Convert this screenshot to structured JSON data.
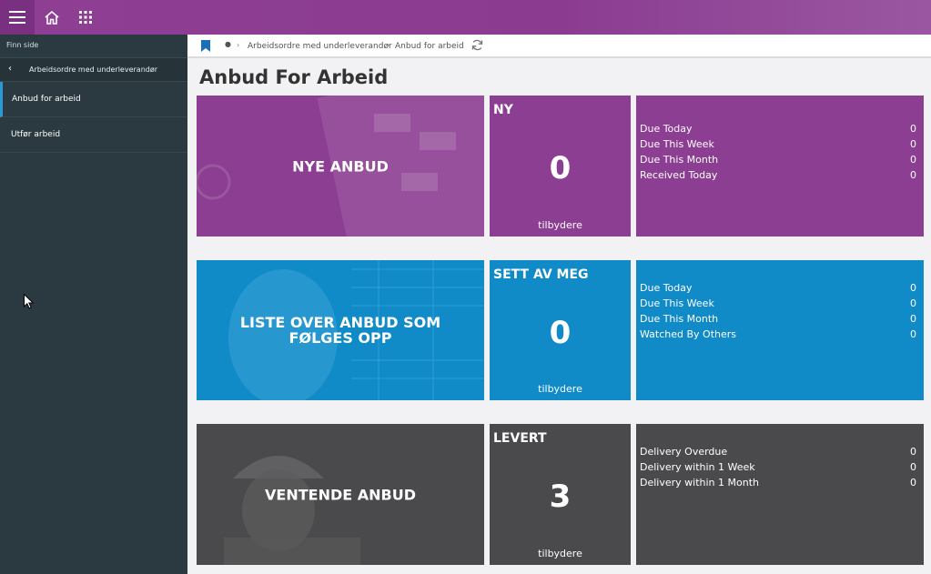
{
  "topbar": {
    "icons": [
      "hamburger-menu-icon",
      "home-icon",
      "apps-grid-icon"
    ]
  },
  "sidebar": {
    "find_label": "Finn side",
    "back_label": "Arbeidsordre med underleverandør",
    "items": [
      {
        "label": "Anbud for arbeid",
        "active": true
      },
      {
        "label": "Utfør arbeid",
        "active": false
      }
    ]
  },
  "breadcrumb": {
    "items": [
      "Arbeidsordre med underleverandør",
      "Anbud for arbeid"
    ]
  },
  "page_title": "Anbud For Arbeid",
  "colors": {
    "purple": "#8c3e92",
    "blue": "#118ac8",
    "dark": "#4a4a4c",
    "sidebar": "#2b3a40"
  },
  "sections": [
    {
      "hero": "NYE ANBUD",
      "count_title": "NY",
      "count": "0",
      "count_sub": "tilbydere",
      "stats": [
        {
          "label": "Due Today",
          "value": "0"
        },
        {
          "label": "Due This Week",
          "value": "0"
        },
        {
          "label": "Due This Month",
          "value": "0"
        },
        {
          "label": "Received Today",
          "value": "0"
        }
      ]
    },
    {
      "hero": "LISTE OVER ANBUD SOM FØLGES OPP",
      "count_title": "SETT AV MEG",
      "count": "0",
      "count_sub": "tilbydere",
      "stats": [
        {
          "label": "Due Today",
          "value": "0"
        },
        {
          "label": "Due This Week",
          "value": "0"
        },
        {
          "label": "Due This Month",
          "value": "0"
        },
        {
          "label": "Watched By Others",
          "value": "0"
        }
      ]
    },
    {
      "hero": "VENTENDE ANBUD",
      "count_title": "LEVERT",
      "count": "3",
      "count_sub": "tilbydere",
      "stats": [
        {
          "label": "Delivery Overdue",
          "value": "0"
        },
        {
          "label": "Delivery within 1 Week",
          "value": "0"
        },
        {
          "label": "Delivery within 1 Month",
          "value": "0"
        }
      ]
    }
  ]
}
